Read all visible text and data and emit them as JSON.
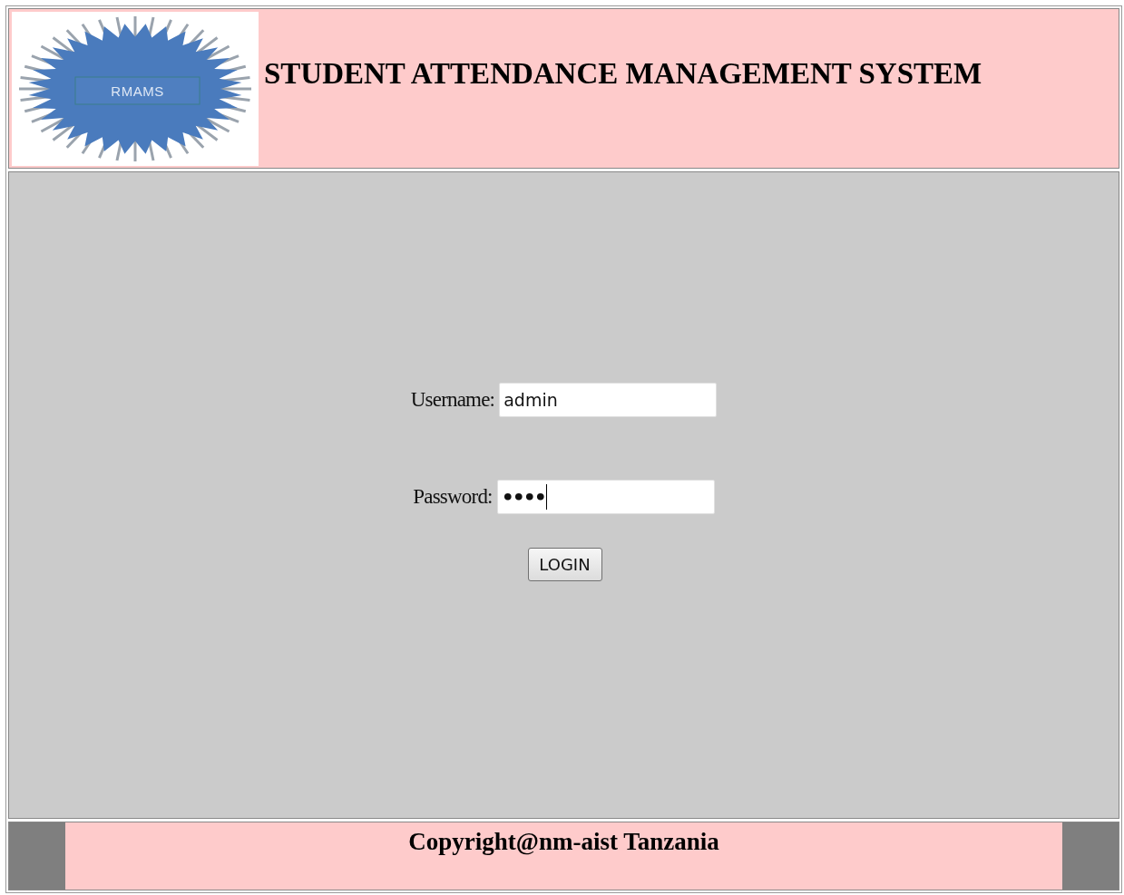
{
  "header": {
    "logo_text": "RMAMS",
    "title": "STUDENT ATTENDANCE MANAGEMENT SYSTEM"
  },
  "login_form": {
    "fields": [
      {
        "label": "Username:",
        "value": "admin",
        "kind": "text",
        "focused": false
      },
      {
        "label": "Password:",
        "value": "••••",
        "kind": "password",
        "focused": true
      }
    ],
    "button": "LOGIN"
  },
  "footer": {
    "text": "Copyright@nm-aist Tanzania"
  }
}
